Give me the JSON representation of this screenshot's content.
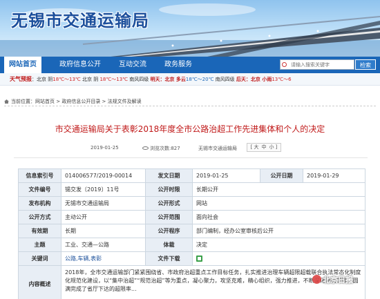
{
  "site": {
    "title": "无锡市交通运输局"
  },
  "nav": {
    "items": [
      {
        "label": "网站首页",
        "active": true
      },
      {
        "label": "政府信息公开",
        "active": false
      },
      {
        "label": "互动交流",
        "active": false
      },
      {
        "label": "政务服务",
        "active": false
      }
    ],
    "search_placeholder": "请输入搜索关键字",
    "search_button": "检索"
  },
  "weather": {
    "label": "天气预报",
    "items": [
      {
        "city": "：北京 阴",
        "temp": "18℃～13℃",
        "temp_color": "hot",
        "tail": " 北京 阴 "
      },
      {
        "city": "",
        "temp": "18℃～13℃",
        "temp_color": "hot",
        "tail": " 南风四级 "
      },
      {
        "city": "明天：北京 多云",
        "temp": "18℃～20℃",
        "temp_color": "cool",
        "tail": " 南风四级 "
      },
      {
        "city": "后天：北京 小雨",
        "temp": "13℃～6",
        "temp_color": "hot",
        "tail": ""
      }
    ]
  },
  "breadcrumb": {
    "prefix": "当前位置：",
    "items": [
      "网站首页",
      "政府信息公开目录",
      "法规文件及解读"
    ],
    "separator": " > "
  },
  "article": {
    "title": "市交通运输局关于表彰2018年度全市公路治超工作先进集体和个人的决定",
    "date": "2019-01-25",
    "views": "浏览次数:827",
    "source": "无锡市交通运输局",
    "font_size_label": "大",
    "font_size_mid": "中",
    "font_size_small": "小",
    "font_open": "[",
    "font_close": "]"
  },
  "info_table": {
    "rows": [
      {
        "k1": "信息索引号",
        "v1": "014006577/2019-00014",
        "k2": "发文日期",
        "v2": "2019-01-25",
        "k3": "公开日期",
        "v3": "2019-01-29"
      },
      {
        "k1": "文件编号",
        "v1": "锡交发〔2019〕11号",
        "k2": "公开时限",
        "v2": "长期公开"
      },
      {
        "k1": "发布机构",
        "v1": "无锡市交通运输局",
        "k2": "公开形式",
        "v2": "网站"
      },
      {
        "k1": "公开方式",
        "v1": "主动公开",
        "k2": "公开范围",
        "v2": "面向社会"
      },
      {
        "k1": "有效期",
        "v1": "长期",
        "k2": "公开程序",
        "v2": "部门编制，经办公室审核后公开"
      },
      {
        "k1": "主题",
        "v1": "工业、交通—公路",
        "k2": "体裁",
        "v2": "决定"
      },
      {
        "k1": "关键词",
        "v1": "公路,车辆,表彰",
        "k2": "文件下载",
        "v2": ""
      }
    ],
    "desc_label": "内容概述",
    "desc_text": "2018年，全市交通运输部门紧紧围绕省、市政府治超重点工作目标任务，扎实推进治理车辆超限超载联合执法常态化制度化规范化建设，以“集中治超”“规范治超”等为重点，凝心聚力，攻坚克难，精心组织，强力推进，不断深化治超工作，圆满完成了省厅下达的超限率..."
  },
  "watermark": {
    "text": "北京日报"
  }
}
